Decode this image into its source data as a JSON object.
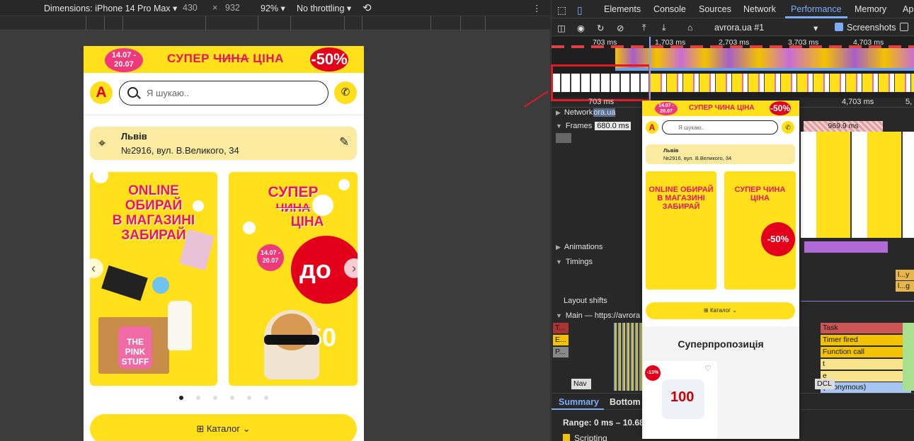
{
  "device_toolbar": {
    "dimensions_label": "Dimensions: iPhone 14 Pro Max",
    "width": "430",
    "times": "×",
    "height": "932",
    "zoom": "92%",
    "throttling": "No throttling",
    "more": "⋮"
  },
  "site": {
    "promo": {
      "date": "14.07 - 20.07",
      "title_a": "СУПЕР ",
      "title_strike": "ЧИНА",
      "title_b": " ЦІНА",
      "badge": "-50%"
    },
    "logo": "A",
    "search_placeholder": "Я шукаю..",
    "store": {
      "city": "Львів",
      "address": "№2916, вул. В.Великого, 34"
    },
    "banner1": {
      "line1": "ONLINE",
      "line2": "ОБИРАЙ",
      "line3": "В МАГАЗИНІ",
      "line4": "ЗАБИРАЙ",
      "product": "THE PINK STUFF"
    },
    "banner2": {
      "line1": "СУПЕР",
      "line2": "ЧИНА",
      "line3": "ЦІНА",
      "date": "14.07 - 20.07",
      "discount": "до -50"
    },
    "slider_prev": "‹",
    "slider_next": "›",
    "catalog_label": "Каталог",
    "active_dot_index": 0
  },
  "devtools": {
    "tabs": [
      "Elements",
      "Console",
      "Sources",
      "Network",
      "Performance",
      "Memory",
      "Ap"
    ],
    "active_tab": "Performance",
    "target": "avrora.ua #1",
    "screenshots_label": "Screenshots",
    "overview_ticks": [
      "703 ms",
      "1,703 ms",
      "2,703 ms",
      "3,703 ms",
      "4,703 ms"
    ],
    "ruler_ticks": [
      "703 ms",
      "4,703 ms",
      "5,"
    ],
    "tracks": {
      "network": "Network",
      "network_url": "ora.ua",
      "frames": "Frames",
      "frame_time": "680.0 ms",
      "animations": "Animations",
      "timings": "Timings",
      "layout_shifts": "Layout shifts",
      "main": "Main — https://avrora",
      "nav": "Nav"
    },
    "timing_labels": [
      "l...y",
      "l...g"
    ],
    "frame_marker": "969.9 ms",
    "flame": {
      "task": "Task",
      "timer": "Timer fired",
      "function": "Function call",
      "t": "t",
      "e": "e",
      "anon": "(anonymous)",
      "dcl": "DCL",
      "e_short": "E...",
      "p_short": "P...",
      "t_short": "T..."
    },
    "bottom_tabs": [
      "Summary",
      "Bottom"
    ],
    "range": "Range: 0 ms – 10.68",
    "scripting": "Scripting"
  },
  "preview": {
    "promo_title": "СУПЕР ЧИНА ЦІНА",
    "badge": "-50%",
    "date": "14.07 - 20.07",
    "logo": "A",
    "search": "Я шукаю..",
    "city": "Львів",
    "address": "№2916, вул. В.Великого, 34",
    "banner1": "ONLINE ОБИРАЙ В МАГАЗИНІ ЗАБИРАЙ",
    "banner2": "СУПЕР ЧИНА ЦІНА",
    "discount": "-50%",
    "catalog": "Каталог",
    "section_title": "Суперпропозиція",
    "disc_badge": "-13%",
    "roll": "100"
  }
}
